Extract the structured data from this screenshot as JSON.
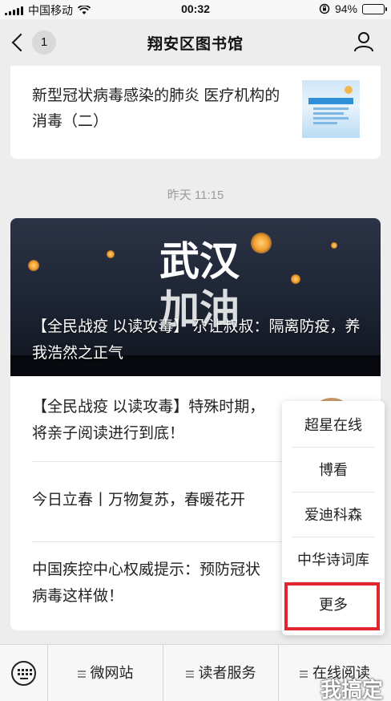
{
  "status_bar": {
    "carrier": "中国移动",
    "time": "00:32",
    "battery_percent": "94%",
    "battery_level": 0.94,
    "icons": [
      "signal-icon",
      "wifi-icon",
      "rotation-lock-icon",
      "battery-icon"
    ]
  },
  "nav": {
    "back_count": "1",
    "title": "翔安区图书馆",
    "icons": [
      "back-chevron-icon",
      "user-profile-icon"
    ]
  },
  "top_article": {
    "title": "新型冠状病毒感染的肺炎 医疗机构的消毒（二）"
  },
  "timestamp": "昨天 11:15",
  "main_article": {
    "hero_text_1": "武汉",
    "hero_text_2": "加油",
    "caption": "【全民战疫 以读攻毒】 尕让叔叔：隔离防疫，养我浩然之正气"
  },
  "articles": [
    {
      "title": "【全民战疫 以读攻毒】特殊时期，将亲子阅读进行到底！"
    },
    {
      "title": "今日立春丨万物复苏，春暖花开"
    },
    {
      "title": "中国疾控中心权威提示：预防冠状病毒这样做！"
    }
  ],
  "popup_menu": {
    "items": [
      "超星在线",
      "博看",
      "爱迪科森",
      "中华诗词库",
      "更多"
    ],
    "highlight_color": "#e0252e"
  },
  "tab_bar": {
    "items": [
      "微网站",
      "读者服务",
      "在线阅读"
    ],
    "icons": [
      "keyboard-icon",
      "menu-lines-icon"
    ]
  },
  "watermark": "我搞定"
}
